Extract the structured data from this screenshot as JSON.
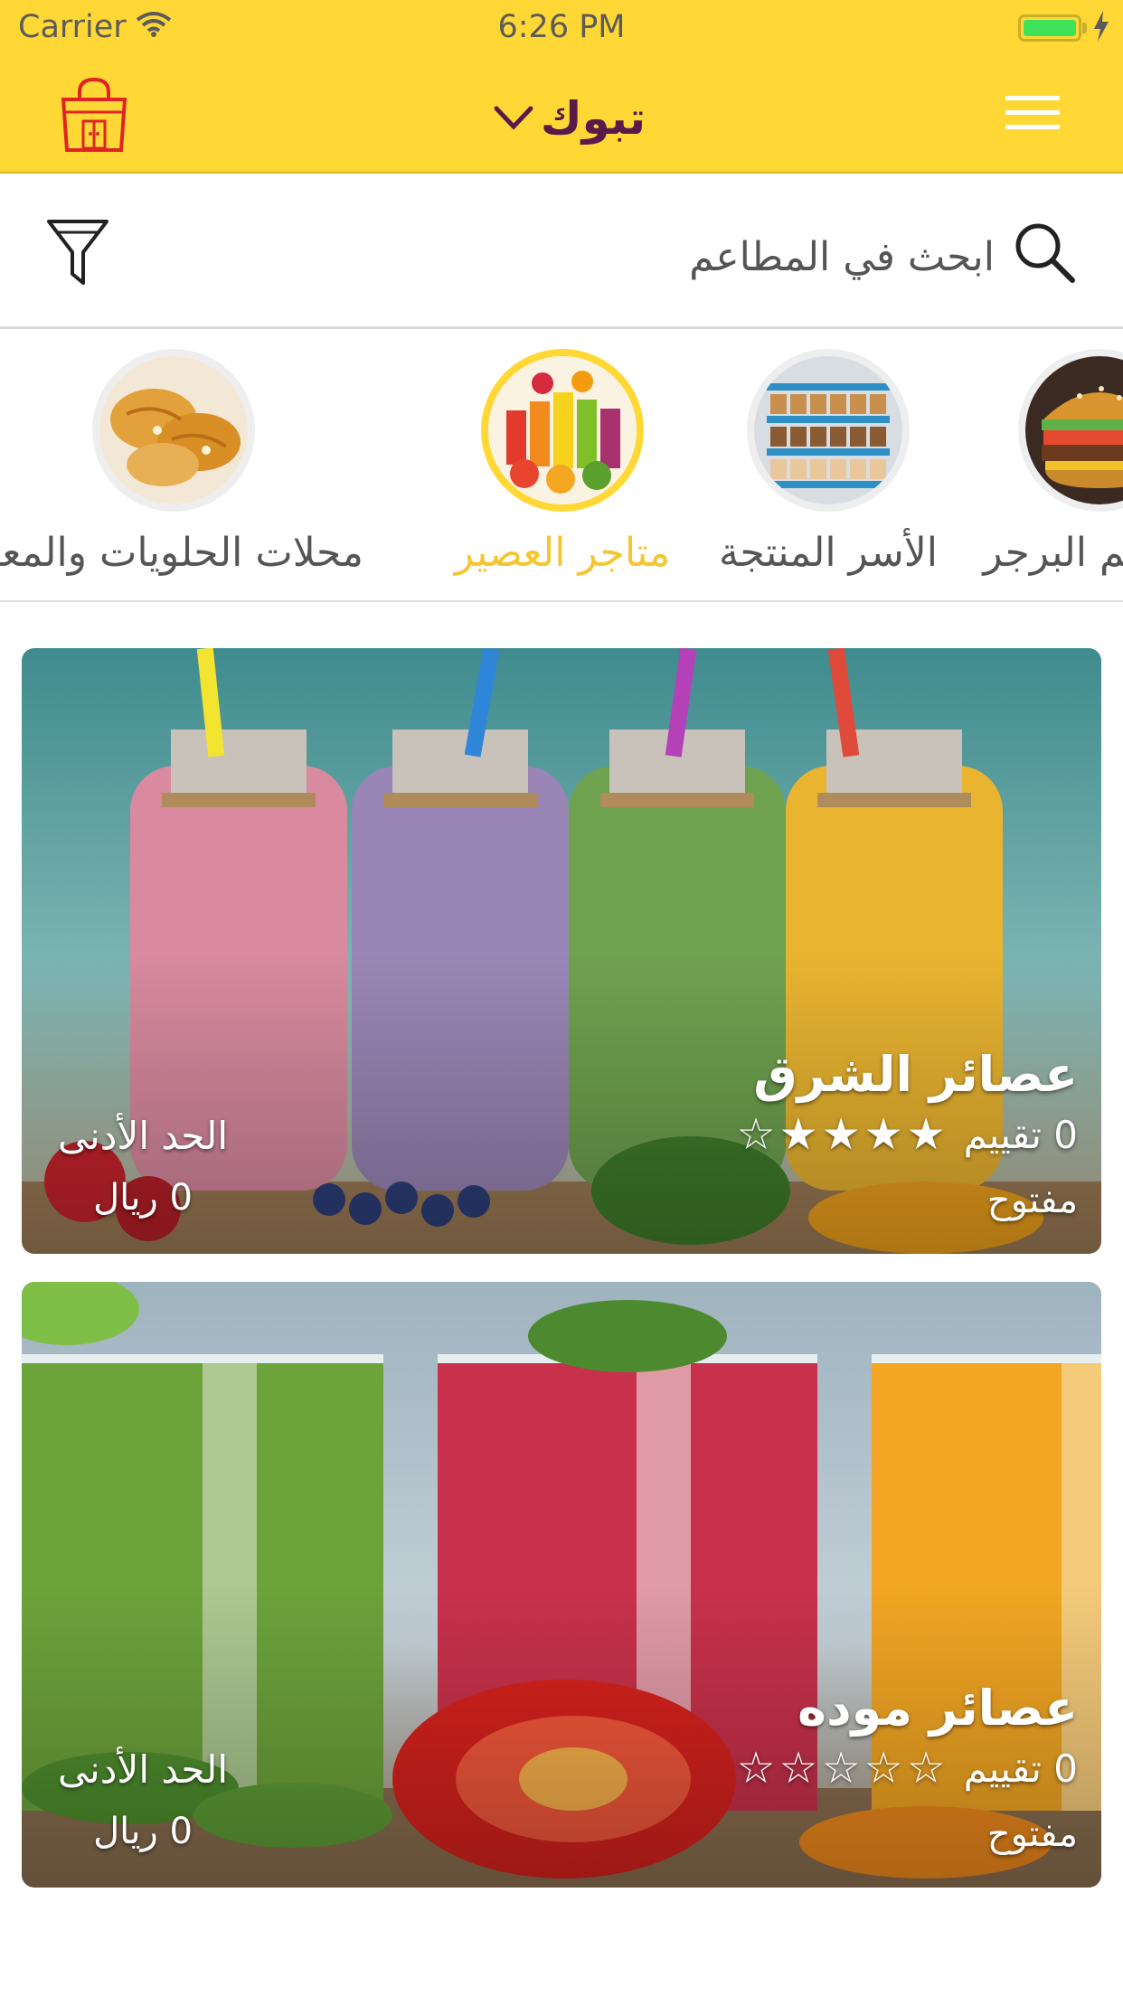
{
  "status_bar": {
    "carrier": "Carrier",
    "time": "6:26 PM"
  },
  "header": {
    "city": "تبوك",
    "icons": [
      "store-bag-icon",
      "chevron-down-icon",
      "hamburger-menu-icon"
    ],
    "colors": {
      "background": "#FFD835",
      "city_text": "#5a1a49",
      "store_icon": "#E02424"
    }
  },
  "search": {
    "placeholder": "ابحث في المطاعم",
    "icons": [
      "search-icon",
      "filter-icon"
    ]
  },
  "categories": [
    {
      "label": "محلات الحلويات والمعجنات",
      "active": false
    },
    {
      "label": "متاجر العصير",
      "active": true
    },
    {
      "label": "الأسر المنتجة",
      "active": false
    },
    {
      "label": "مطاعم البرجر",
      "active": false
    }
  ],
  "restaurants": [
    {
      "name": "عصائر الشرق",
      "rating_text": "0 تقييم",
      "stars": "☆★★★★",
      "status": "مفتوح",
      "min_label": "الحد الأدنى",
      "min_value": "0 ريال"
    },
    {
      "name": "عصائر موده",
      "rating_text": "0 تقييم",
      "stars": "☆☆☆☆☆",
      "status": "مفتوح",
      "min_label": "الحد الأدنى",
      "min_value": "0 ريال"
    }
  ],
  "accent_colors": {
    "active_category": "#F5C632",
    "brand_yellow": "#FFD835"
  }
}
